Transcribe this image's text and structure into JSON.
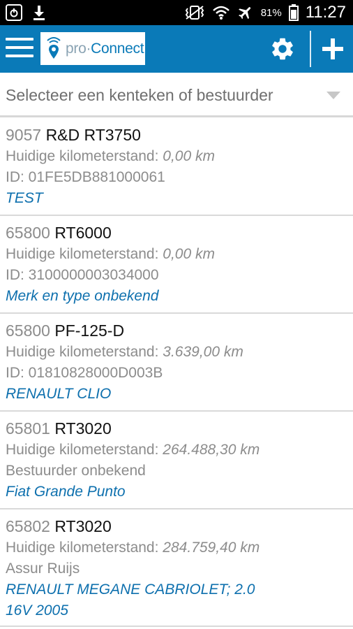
{
  "status_bar": {
    "battery_percent": "81%",
    "time": "11:27",
    "icons": [
      "screenshot-icon",
      "download-icon",
      "vibrate-icon",
      "wifi-icon",
      "airplane-icon",
      "battery-icon"
    ]
  },
  "app_bar": {
    "logo_prefix": "pro·",
    "logo_name": "Connect",
    "icons": [
      "menu-icon",
      "gear-icon",
      "plus-icon"
    ],
    "color": "#0a7ab8"
  },
  "selector": {
    "placeholder": "Selecteer een kenteken of bestuurder"
  },
  "vehicles": [
    {
      "number": "9057",
      "plate": "R&D RT3750",
      "km_label": "Huidige kilometerstand:",
      "km_value": "0,00 km",
      "info": "ID: 01FE5DB881000061",
      "model": "TEST"
    },
    {
      "number": "65800",
      "plate": "RT6000",
      "km_label": "Huidige kilometerstand:",
      "km_value": "0,00 km",
      "info": "ID: 3100000003034000",
      "model": "Merk en type onbekend"
    },
    {
      "number": "65800",
      "plate": "PF-125-D",
      "km_label": "Huidige kilometerstand:",
      "km_value": "3.639,00 km",
      "info": "ID: 01810828000D003B",
      "model": "RENAULT CLIO"
    },
    {
      "number": "65801",
      "plate": "RT3020",
      "km_label": "Huidige kilometerstand:",
      "km_value": "264.488,30 km",
      "info": "Bestuurder onbekend",
      "model": "Fiat Grande Punto"
    },
    {
      "number": "65802",
      "plate": "RT3020",
      "km_label": "Huidige kilometerstand:",
      "km_value": "284.759,40 km",
      "info": "Assur Ruijs",
      "model": "RENAULT MEGANE CABRIOLET; 2.0 16V 2005"
    }
  ]
}
